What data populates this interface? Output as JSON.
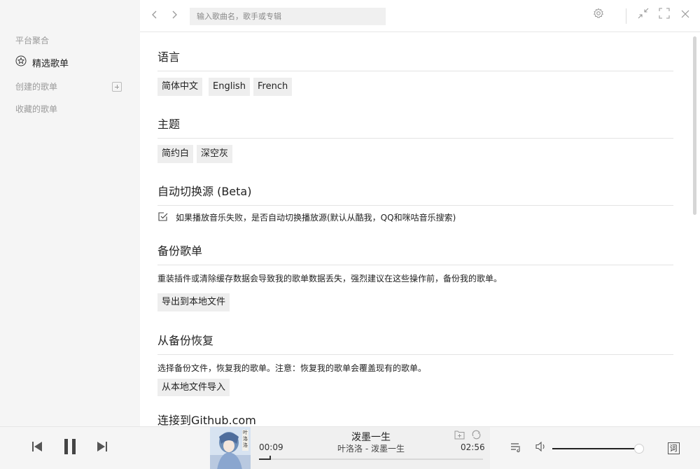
{
  "sidebar": {
    "platform_heading": "平台聚合",
    "featured_label": "精选歌单",
    "created_heading": "创建的歌单",
    "collected_heading": "收藏的歌单"
  },
  "topbar": {
    "search_placeholder": "输入歌曲名，歌手或专辑"
  },
  "settings": {
    "language": {
      "title": "语言",
      "options": [
        "简体中文",
        "English",
        "French"
      ]
    },
    "theme": {
      "title": "主题",
      "options": [
        "简约白",
        "深空灰"
      ]
    },
    "auto_switch": {
      "title": "自动切换源 (Beta)",
      "checkbox_label": "如果播放音乐失败，是否自动切换播放源(默认从酷我，QQ和咪咕音乐搜索)",
      "checked": true
    },
    "backup": {
      "title": "备份歌单",
      "description": "重装插件或清除缓存数据会导致我的歌单数据丢失，强烈建议在这些操作前，备份我的歌单。",
      "button_label": "导出到本地文件"
    },
    "restore": {
      "title": "从备份恢复",
      "description": "选择备份文件，恢复我的歌单。注意：恢复我的歌单会覆盖现有的歌单。",
      "button_label": "从本地文件导入"
    },
    "github": {
      "title": "连接到Github.com"
    }
  },
  "player": {
    "song_title": "泼墨一生",
    "song_subtitle": "叶洛洛 - 泼墨一生",
    "current_time": "00:09",
    "duration": "02:56",
    "progress_fraction": 0.05,
    "volume_fraction": 0.97,
    "cover_text": "叶洛洛",
    "lyrics_button_label": "词"
  }
}
